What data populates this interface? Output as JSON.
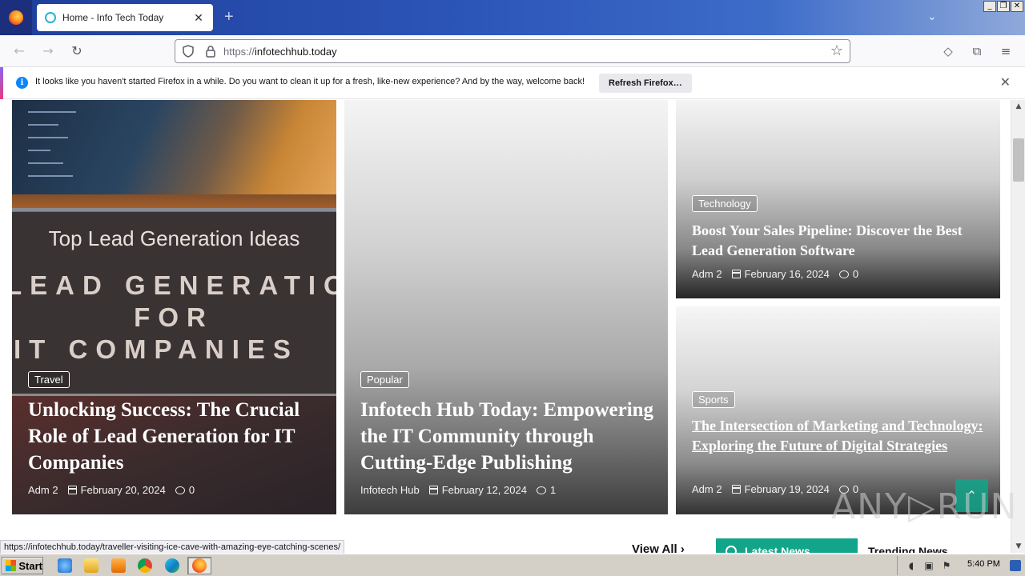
{
  "browser": {
    "tab": {
      "title": "Home - Info Tech Today",
      "close_glyph": "✕"
    },
    "new_tab_glyph": "+",
    "tab_list_glyph": "⌄",
    "window_controls": [
      "_",
      "❐",
      "✕"
    ],
    "nav": {
      "back": "←",
      "forward": "→",
      "reload": "↻"
    },
    "url": {
      "scheme": "https://",
      "host": "infotechhub.today"
    },
    "bookmark_glyph": "☆",
    "tools": {
      "pocket": "◇",
      "extensions": "⧉",
      "menu": "≡"
    }
  },
  "notification": {
    "message": "It looks like you haven't started Firefox in a while. Do you want to clean it up for a fresh, like-new experience? And by the way, welcome back!",
    "button": "Refresh Firefox…",
    "close": "✕",
    "info_glyph": "i"
  },
  "posts": [
    {
      "category": "Travel",
      "title": "Unlocking Success: The Crucial Role of Lead Generation for IT Companies",
      "author": "Adm 2",
      "date": "February 20, 2024",
      "comments": "0",
      "image_text": {
        "heading": "Top Lead Generation Ideas",
        "line1": "LEAD GENERATIO",
        "line2": "FOR",
        "line3": "IT COMPANIES"
      }
    },
    {
      "category": "Popular",
      "title": "Infotech Hub Today: Empowering the IT Community through Cutting-Edge Publishing",
      "author": "Infotech Hub",
      "date": "February 12, 2024",
      "comments": "1"
    },
    {
      "category": "Technology",
      "title": "Boost Your Sales Pipeline: Discover the Best Lead Generation Software",
      "author": "Adm 2",
      "date": "February 16, 2024",
      "comments": "0"
    },
    {
      "category": "Sports",
      "title": "The Intersection of Marketing and Technology: Exploring the Future of Digital Strategies",
      "author": "Adm 2",
      "date": "February 19, 2024",
      "comments": "0"
    }
  ],
  "section_bar": {
    "view_all": "View All ›",
    "latest_news": "Latest News",
    "trending_news": "Trending News"
  },
  "back_to_top_glyph": "⌃",
  "watermark": "ANY▷RUN",
  "status_url": "https://infotechhub.today/traveller-visiting-ice-cave-with-amazing-eye-catching-scenes/",
  "taskbar": {
    "start": "Start",
    "clock": "5:40 PM"
  },
  "colors": {
    "accent": "#12a58a",
    "tab_bar": "#2c55b8",
    "info_blue": "#0a84ff"
  }
}
